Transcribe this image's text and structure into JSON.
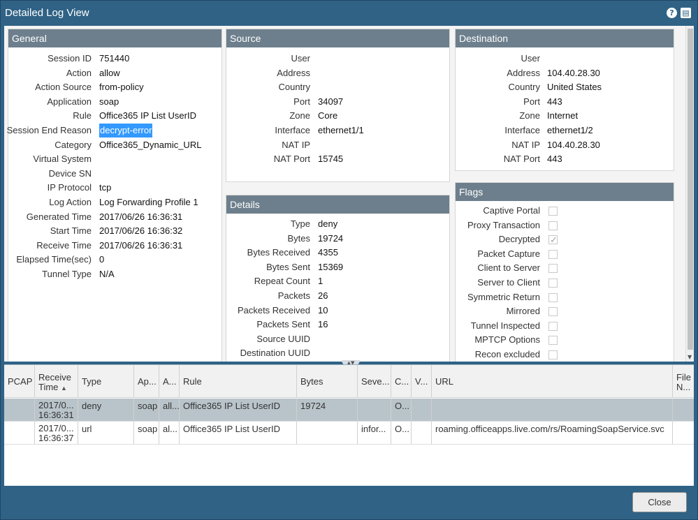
{
  "window": {
    "title": "Detailed Log View",
    "help_icon": "?",
    "maximize_icon": "maximize"
  },
  "general": {
    "header": "General",
    "rows": [
      {
        "label": "Session ID",
        "value": "751440"
      },
      {
        "label": "Action",
        "value": "allow"
      },
      {
        "label": "Action Source",
        "value": "from-policy"
      },
      {
        "label": "Application",
        "value": "soap"
      },
      {
        "label": "Rule",
        "value": "Office365 IP List UserID"
      },
      {
        "label": "Session End Reason",
        "value": "decrypt-error"
      },
      {
        "label": "Category",
        "value": "Office365_Dynamic_URL"
      },
      {
        "label": "Virtual System",
        "value": ""
      },
      {
        "label": "Device SN",
        "value": ""
      },
      {
        "label": "IP Protocol",
        "value": "tcp"
      },
      {
        "label": "Log Action",
        "value": "Log Forwarding Profile 1"
      },
      {
        "label": "Generated Time",
        "value": "2017/06/26 16:36:31"
      },
      {
        "label": "Start Time",
        "value": "2017/06/26 16:36:32"
      },
      {
        "label": "Receive Time",
        "value": "2017/06/26 16:36:31"
      },
      {
        "label": "Elapsed Time(sec)",
        "value": "0"
      },
      {
        "label": "Tunnel Type",
        "value": "N/A"
      }
    ]
  },
  "source": {
    "header": "Source",
    "rows": [
      {
        "label": "User",
        "value": ""
      },
      {
        "label": "Address",
        "value": ""
      },
      {
        "label": "Country",
        "value": ""
      },
      {
        "label": "Port",
        "value": "34097"
      },
      {
        "label": "Zone",
        "value": "Core"
      },
      {
        "label": "Interface",
        "value": "ethernet1/1"
      },
      {
        "label": "NAT IP",
        "value": ""
      },
      {
        "label": "NAT Port",
        "value": "15745"
      }
    ]
  },
  "destination": {
    "header": "Destination",
    "rows": [
      {
        "label": "User",
        "value": ""
      },
      {
        "label": "Address",
        "value": "104.40.28.30"
      },
      {
        "label": "Country",
        "value": "United States"
      },
      {
        "label": "Port",
        "value": "443"
      },
      {
        "label": "Zone",
        "value": "Internet"
      },
      {
        "label": "Interface",
        "value": "ethernet1/2"
      },
      {
        "label": "NAT IP",
        "value": "104.40.28.30"
      },
      {
        "label": "NAT Port",
        "value": "443"
      }
    ]
  },
  "details": {
    "header": "Details",
    "rows": [
      {
        "label": "Type",
        "value": "deny"
      },
      {
        "label": "Bytes",
        "value": "19724"
      },
      {
        "label": "Bytes Received",
        "value": "4355"
      },
      {
        "label": "Bytes Sent",
        "value": "15369"
      },
      {
        "label": "Repeat Count",
        "value": "1"
      },
      {
        "label": "Packets",
        "value": "26"
      },
      {
        "label": "Packets Received",
        "value": "10"
      },
      {
        "label": "Packets Sent",
        "value": "16"
      },
      {
        "label": "Source UUID",
        "value": ""
      },
      {
        "label": "Destination UUID",
        "value": ""
      }
    ]
  },
  "flags": {
    "header": "Flags",
    "rows": [
      {
        "label": "Captive Portal",
        "checked": false
      },
      {
        "label": "Proxy Transaction",
        "checked": false
      },
      {
        "label": "Decrypted",
        "checked": true
      },
      {
        "label": "Packet Capture",
        "checked": false
      },
      {
        "label": "Client to Server",
        "checked": false
      },
      {
        "label": "Server to Client",
        "checked": false
      },
      {
        "label": "Symmetric Return",
        "checked": false
      },
      {
        "label": "Mirrored",
        "checked": false
      },
      {
        "label": "Tunnel Inspected",
        "checked": false
      },
      {
        "label": "MPTCP Options",
        "checked": false
      },
      {
        "label": "Recon excluded",
        "checked": false
      }
    ]
  },
  "grid": {
    "columns": {
      "pcap": "PCAP",
      "receive_time": "Receive Time",
      "type": "Type",
      "app": "Ap...",
      "action": "A...",
      "rule": "Rule",
      "bytes": "Bytes",
      "severity": "Seve...",
      "category": "C...",
      "vsys": "V...",
      "url": "URL",
      "file_name": "File N..."
    },
    "rows": [
      {
        "pcap": "",
        "receive_time": "2017/0... 16:36:31",
        "type": "deny",
        "app": "soap",
        "action": "all...",
        "rule": "Office365 IP List UserID",
        "bytes": "19724",
        "severity": "",
        "category": "O...",
        "vsys": "",
        "url": "",
        "file_name": ""
      },
      {
        "pcap": "",
        "receive_time": "2017/0... 16:36:37",
        "type": "url",
        "app": "soap",
        "action": "al...",
        "rule": "Office365 IP List UserID",
        "bytes": "",
        "severity": "infor...",
        "category": "O...",
        "vsys": "",
        "url": "roaming.officeapps.live.com/rs/RoamingSoapService.svc",
        "file_name": ""
      }
    ]
  },
  "footer": {
    "close_label": "Close"
  }
}
